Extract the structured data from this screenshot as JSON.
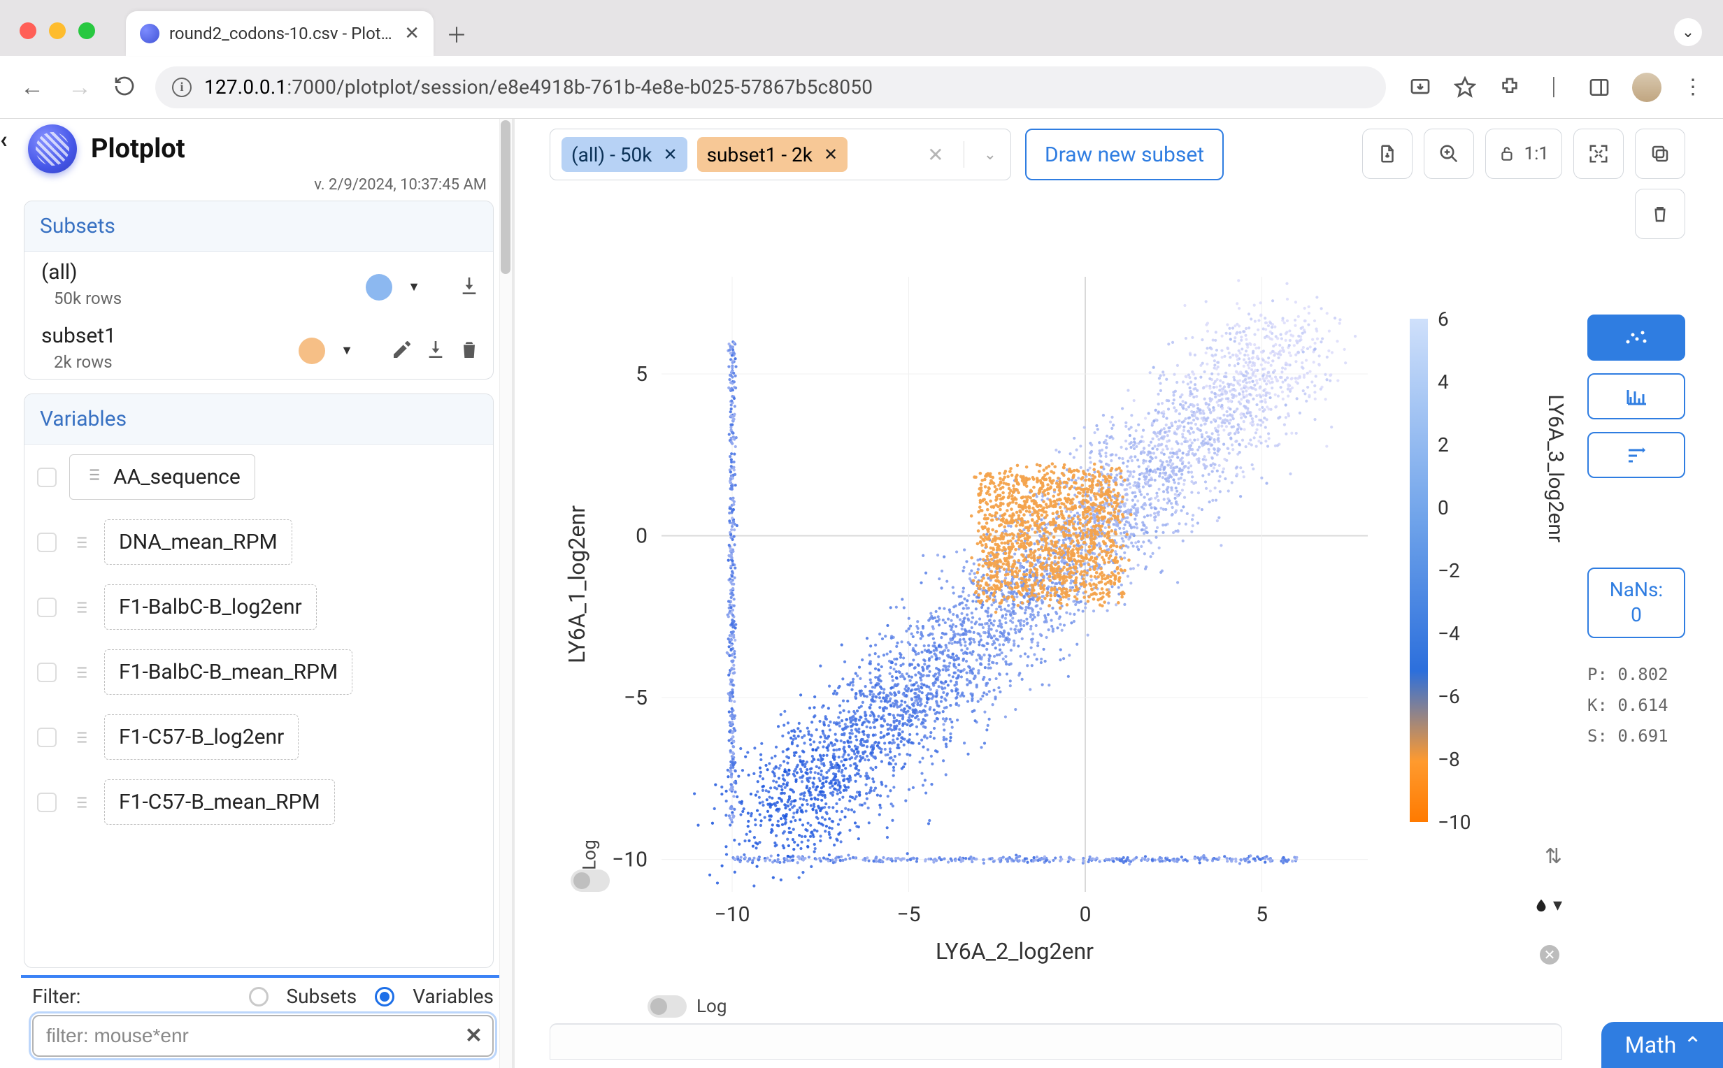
{
  "browser": {
    "tab_title": "round2_codons-10.csv - Plot…",
    "url_host": "127.0.0.1",
    "url_path": ":7000/plotplot/session/e8e4918b-761b-4e8e-b025-57867b5c8050"
  },
  "app": {
    "name": "Plotplot",
    "version": "v. 2/9/2024, 10:37:45 AM"
  },
  "sidebar": {
    "subsets_header": "Subsets",
    "variables_header": "Variables",
    "subsets": [
      {
        "name": "(all)",
        "meta": "50k rows",
        "color": "#8cb8f0"
      },
      {
        "name": "subset1",
        "meta": "2k rows",
        "color": "#f6bf86"
      }
    ],
    "variables": [
      {
        "label": "AA_sequence",
        "solid": true
      },
      {
        "label": "DNA_mean_RPM"
      },
      {
        "label": "F1-BalbC-B_log2enr"
      },
      {
        "label": "F1-BalbC-B_mean_RPM"
      },
      {
        "label": "F1-C57-B_log2enr"
      },
      {
        "label": "F1-C57-B_mean_RPM"
      }
    ]
  },
  "filter": {
    "label": "Filter:",
    "option_subsets": "Subsets",
    "option_variables": "Variables",
    "selected": "Variables",
    "placeholder": "filter: mouse*enr"
  },
  "plot": {
    "chips": [
      {
        "label": "(all) - 50k",
        "cls": "blue"
      },
      {
        "label": "subset1 - 2k",
        "cls": "orange"
      }
    ],
    "draw_label": "Draw new subset",
    "ratio_label": "1:1",
    "log_label": "Log",
    "nan_label": "NaNs:",
    "nan_value": "0",
    "stats": {
      "P": "0.802",
      "K": "0.614",
      "S": "0.691"
    }
  },
  "chart_data": {
    "type": "scatter",
    "title": "",
    "xlabel": "LY6A_2_log2enr",
    "ylabel": "LY6A_1_log2enr",
    "colorlabel": "LY6A_3_log2enr",
    "xlim": [
      -12,
      8
    ],
    "ylim": [
      -11,
      8
    ],
    "xticks": [
      -10,
      -5,
      0,
      5
    ],
    "yticks": [
      -10,
      -5,
      0,
      5
    ],
    "color_ticks": [
      6,
      4,
      2,
      0,
      -2,
      -4,
      -6,
      -8,
      -10
    ],
    "color_range": [
      -10,
      6
    ],
    "series": [
      {
        "name": "(all)",
        "n": 50000,
        "color_by": "LY6A_3_log2enr",
        "distribution": "diagonal cloud roughly along y=x from (-10,-10) to (6,6); vertical stripe at x≈-10 spanning y∈[-9,6]; horizontal stripe at y≈-10 spanning x∈[-10,6]; color (LY6A_3_log2enr) increases with x,y (blue at low, light at high)"
      },
      {
        "name": "subset1",
        "n": 2000,
        "color": "#f3a24b",
        "distribution": "rectangular selection approximately x∈[-3,1], y∈[-2,2] overlaid on the main cloud"
      }
    ]
  },
  "math_label": "Math"
}
